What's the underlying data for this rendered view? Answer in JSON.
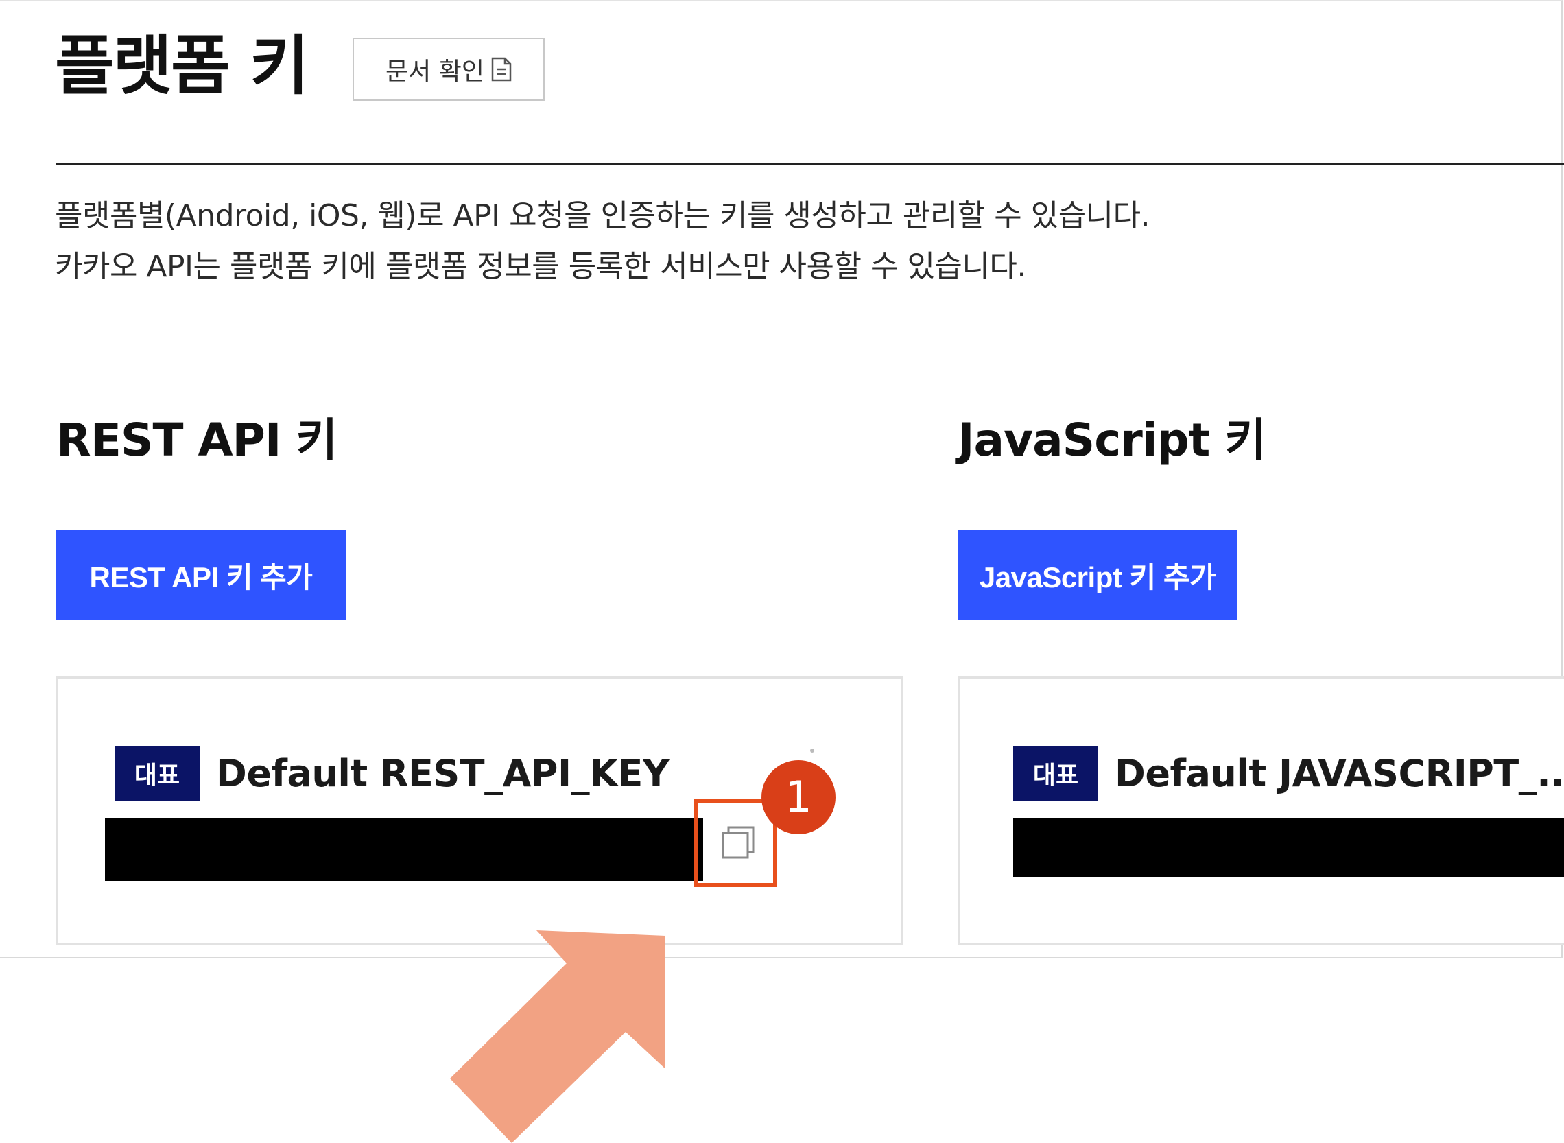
{
  "page": {
    "title": "플랫폼 키",
    "doc_button_label": "문서 확인",
    "description": [
      "플랫폼별(Android, iOS, 웹)로 API 요청을 인증하는 키를 생성하고 관리할 수 있습니다.",
      "카카오 API는 플랫폼 키에 플랫폼 정보를 등록한 서비스만 사용할 수 있습니다."
    ]
  },
  "rest_api": {
    "heading": "REST API 키",
    "add_button": "REST API 키 추가",
    "card": {
      "badge": "대표",
      "name": "Default REST_API_KEY"
    }
  },
  "javascript": {
    "heading": "JavaScript 키",
    "add_button": "JavaScript 키 추가",
    "card": {
      "badge": "대표",
      "name": "Default JAVASCRIPT_..."
    }
  },
  "annotation": {
    "step_number": "1",
    "highlight_color": "#e8501c",
    "badge_color": "#d93f18",
    "arrow_color": "#f2a283"
  },
  "colors": {
    "primary_button": "#2f54ff",
    "badge_background": "#0b1466"
  },
  "icons": {
    "doc": "document-icon",
    "copy": "copy-icon",
    "arrow": "pointer-arrow"
  }
}
